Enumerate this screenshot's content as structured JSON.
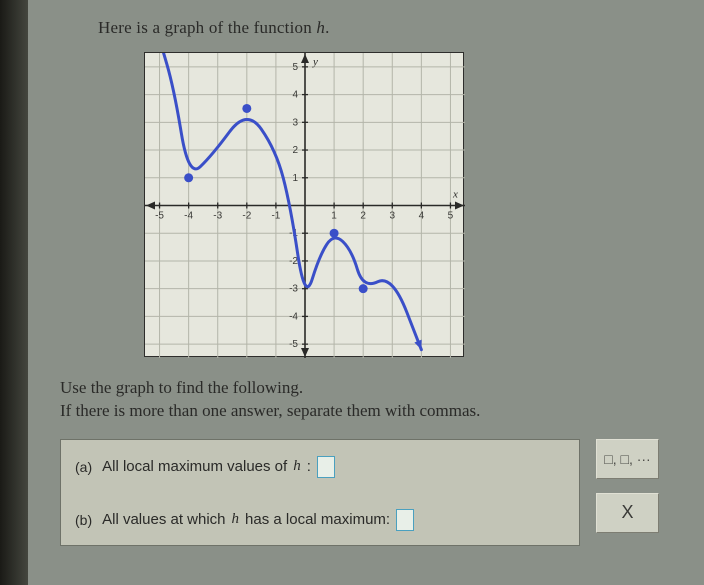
{
  "intro_prefix": "Here is a graph of the function ",
  "intro_fn": "h",
  "intro_suffix": ".",
  "followup_line1": "Use the graph to find the following.",
  "followup_line2": "If there is more than one answer, separate them with commas.",
  "parts": {
    "a": {
      "label": "(a)",
      "text_pre": "All local maximum values of ",
      "fn": "h",
      "text_post": ":"
    },
    "b": {
      "label": "(b)",
      "text_pre": "All values at which ",
      "fn": "h",
      "text_post": " has a local maximum:"
    }
  },
  "side": {
    "list_hint": "□, □, ···",
    "clear": "X"
  },
  "chart_data": {
    "type": "line",
    "xlabel": "x",
    "ylabel": "y",
    "xlim": [
      -5.5,
      5.5
    ],
    "ylim": [
      -5.5,
      5.5
    ],
    "xticks": [
      -5,
      -4,
      -3,
      -2,
      -1,
      1,
      2,
      3,
      4,
      5
    ],
    "yticks": [
      -5,
      -4,
      -3,
      -2,
      -1,
      1,
      2,
      3,
      4,
      5
    ],
    "curve": [
      {
        "x": -5,
        "y": 6
      },
      {
        "x": -4.5,
        "y": 4.2
      },
      {
        "x": -4,
        "y": 1
      },
      {
        "x": -3.2,
        "y": 1.8
      },
      {
        "x": -2,
        "y": 3.5
      },
      {
        "x": -1,
        "y": 2
      },
      {
        "x": -0.5,
        "y": 0
      },
      {
        "x": 0,
        "y": -3.5
      },
      {
        "x": 0.5,
        "y": -1.8
      },
      {
        "x": 1,
        "y": -1
      },
      {
        "x": 1.6,
        "y": -1.6
      },
      {
        "x": 2,
        "y": -3
      },
      {
        "x": 3,
        "y": -2.5
      },
      {
        "x": 4,
        "y": -5.2
      }
    ],
    "closed_points": [
      {
        "x": -4,
        "y": 1
      },
      {
        "x": -2,
        "y": 3.5
      },
      {
        "x": 1,
        "y": -1
      },
      {
        "x": 2,
        "y": -3
      }
    ],
    "arrows": {
      "start": true,
      "end": true
    }
  }
}
